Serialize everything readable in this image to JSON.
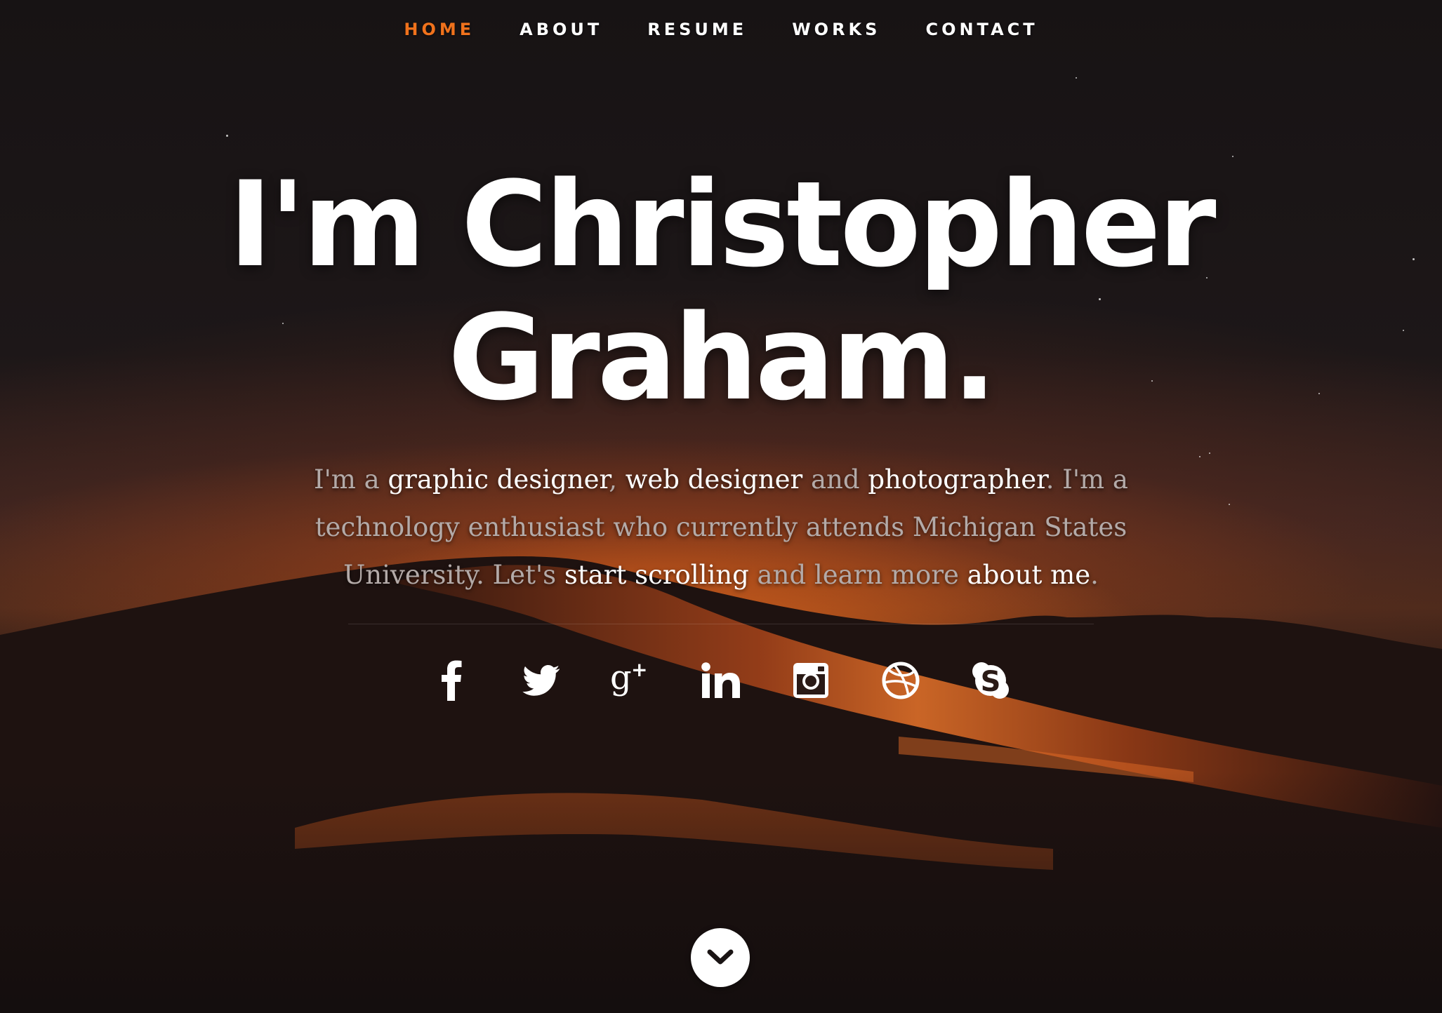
{
  "nav": {
    "items": [
      {
        "label": "HOME",
        "active": true
      },
      {
        "label": "ABOUT",
        "active": false
      },
      {
        "label": "RESUME",
        "active": false
      },
      {
        "label": "WORKS",
        "active": false
      },
      {
        "label": "CONTACT",
        "active": false
      }
    ]
  },
  "hero": {
    "headline_line1": "I'm Christopher",
    "headline_line2": "Graham.",
    "intro": {
      "t1": "I'm a ",
      "graphic_designer": "graphic designer",
      "t2": ", ",
      "web_designer": "web designer",
      "t3": " and ",
      "photographer": "photographer",
      "t4": ". I'm a technology enthusiast who currently attends Michigan States University. Let's ",
      "start_scrolling": "start scrolling",
      "t5": " and learn more ",
      "about_me": "about me",
      "t6": "."
    }
  },
  "social": {
    "icons": [
      "facebook-icon",
      "twitter-icon",
      "google-plus-icon",
      "linkedin-icon",
      "instagram-icon",
      "dribbble-icon",
      "skype-icon"
    ]
  },
  "scroll_down": {
    "icon": "chevron-down-icon"
  },
  "colors": {
    "accent": "#f0721c",
    "background": "#1a1414",
    "text": "#ffffff",
    "muted_text": "#b3aaa8"
  }
}
